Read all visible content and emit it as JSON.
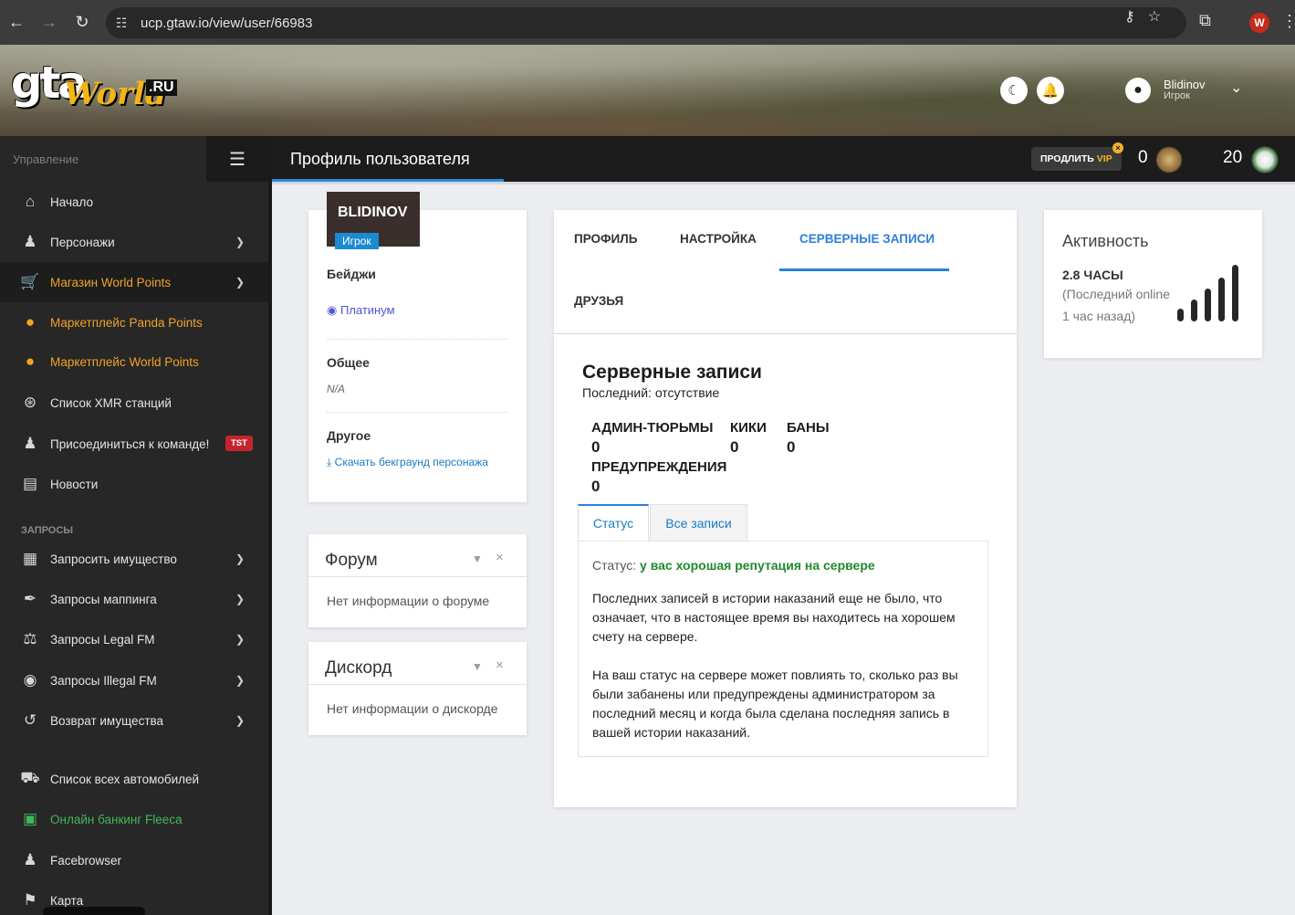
{
  "browser": {
    "url": "ucp.gtaw.io/view/user/66983",
    "profile_initial": "W"
  },
  "banner": {
    "logo_gta": "gta",
    "logo_world": "World",
    "logo_ru": ".RU",
    "user_name": "Blidinov",
    "user_role": "Игрок"
  },
  "sidebar": {
    "header_label": "Управление",
    "section_requests": "ЗАПРОСЫ",
    "items": [
      {
        "label": "Начало",
        "icon": "home-icon"
      },
      {
        "label": "Персонажи",
        "icon": "user-icon"
      },
      {
        "label": "Магазин World Points",
        "icon": "cart-icon"
      },
      {
        "label": "Маркетплейс Panda Points",
        "icon": "coins-icon"
      },
      {
        "label": "Маркетплейс World Points",
        "icon": "coins-icon"
      },
      {
        "label": "Список XMR станций",
        "icon": "broadcast-icon"
      },
      {
        "label": "Присоединиться к команде!",
        "icon": "user-tie-icon",
        "badge": "TST"
      },
      {
        "label": "Новости",
        "icon": "newspaper-icon"
      },
      {
        "label": "Запросить имущество",
        "icon": "building-icon"
      },
      {
        "label": "Запросы маппинга",
        "icon": "brush-icon"
      },
      {
        "label": "Запросы Legal FM",
        "icon": "scale-icon"
      },
      {
        "label": "Запросы Illegal FM",
        "icon": "mask-icon"
      },
      {
        "label": "Возврат имущества",
        "icon": "undo-icon"
      },
      {
        "label": "Список всех автомобилей",
        "icon": "car-icon"
      },
      {
        "label": "Онлайн банкинг Fleeca",
        "icon": "money-icon"
      },
      {
        "label": "Facebrowser",
        "icon": "users-icon"
      },
      {
        "label": "Карта",
        "icon": "map-icon"
      }
    ]
  },
  "topbar": {
    "title": "Профиль пользователя",
    "vip_prefix": "ПРОДЛИТЬ",
    "vip_word": "VIP",
    "world_points": "0",
    "panda_points": "20"
  },
  "profile": {
    "name": "BLIDINOV",
    "role": "Игрок",
    "badges_heading": "Бейджи",
    "badge_platinum": "Платинум",
    "general_heading": "Общее",
    "general_value": "N/A",
    "other_heading": "Другое",
    "download_link": "Скачать бекграунд персонажа"
  },
  "forum": {
    "title": "Форум",
    "text": "Нет информации о форуме"
  },
  "discord": {
    "title": "Дискорд",
    "text": "Нет информации о дискорде"
  },
  "tabs": {
    "profile": "ПРОФИЛЬ",
    "settings": "НАСТРОЙКА",
    "server_records": "СЕРВЕРНЫЕ ЗАПИСИ",
    "friends": "ДРУЗЬЯ"
  },
  "records": {
    "title": "Серверные записи",
    "last": "Последний: отсутствие",
    "jails_label": "АДМИН-ТЮРЬМЫ",
    "jails_value": "0",
    "kicks_label": "КИКИ",
    "kicks_value": "0",
    "bans_label": "БАНЫ",
    "bans_value": "0",
    "warnings_label": "ПРЕДУПРЕЖДЕНИЯ",
    "warnings_value": "0",
    "subtab_status": "Статус",
    "subtab_all": "Все записи",
    "status_prefix": "Статус:",
    "status_value": "у вас хорошая репутация на сервере",
    "para1": "Последних записей в истории наказаний еще не было, что означает, что в настоящее время вы находитесь на хорошем счету на сервере.",
    "para2": "На ваш статус на сервере может повлиять то, сколько раз вы были забанены или предупреждены администратором за последний месяц и когда была сделана последняя запись в вашей истории наказаний."
  },
  "activity": {
    "title": "Активность",
    "hours": "2.8 ЧАСЫ",
    "last_online": "(Последний online",
    "ago": "1 час назад)",
    "signal_level": 5
  }
}
